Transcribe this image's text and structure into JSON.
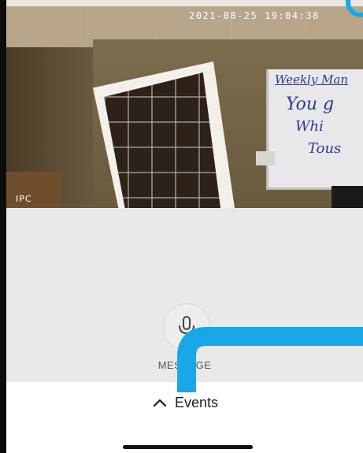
{
  "camera": {
    "timestamp": "2021-08-25 19:04:38",
    "label": "IPC",
    "whiteboard": {
      "title": "Weekly Man",
      "line1": "You g",
      "line2": "Whi",
      "line3": "Tous"
    }
  },
  "controls": {
    "mic_label": "MESSAGE"
  },
  "events": {
    "label": "Events"
  },
  "colors": {
    "accent": "#1aa7e8",
    "panel": "#e9e9e9",
    "bar": "#ffffff"
  }
}
